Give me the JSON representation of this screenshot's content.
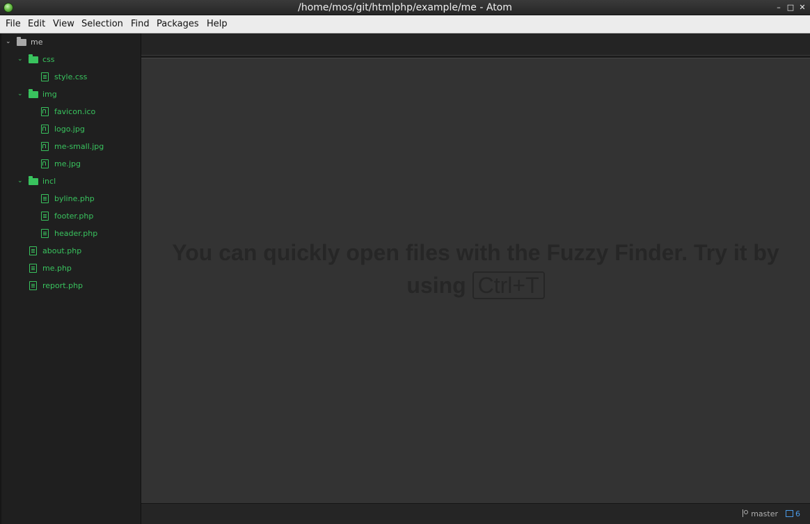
{
  "window": {
    "title": "/home/mos/git/htmlphp/example/me - Atom",
    "controls": {
      "minimize": "–",
      "maximize": "□",
      "close": "✕"
    }
  },
  "menubar": {
    "items": [
      "File",
      "Edit",
      "View",
      "Selection",
      "Find",
      "Packages",
      "Help"
    ]
  },
  "tree": {
    "root": "me",
    "items": [
      {
        "label": "css",
        "type": "folder",
        "expanded": true
      },
      {
        "label": "style.css",
        "type": "file"
      },
      {
        "label": "img",
        "type": "folder",
        "expanded": true
      },
      {
        "label": "favicon.ico",
        "type": "image"
      },
      {
        "label": "logo.jpg",
        "type": "image"
      },
      {
        "label": "me-small.jpg",
        "type": "image"
      },
      {
        "label": "me.jpg",
        "type": "image"
      },
      {
        "label": "incl",
        "type": "folder",
        "expanded": true
      },
      {
        "label": "byline.php",
        "type": "file"
      },
      {
        "label": "footer.php",
        "type": "file"
      },
      {
        "label": "header.php",
        "type": "file"
      },
      {
        "label": "about.php",
        "type": "file"
      },
      {
        "label": "me.php",
        "type": "file"
      },
      {
        "label": "report.php",
        "type": "file"
      }
    ]
  },
  "editor": {
    "hint_text": "You can quickly open files with the Fuzzy Finder. Try it by using",
    "hint_key": "Ctrl+T"
  },
  "statusbar": {
    "branch": "master",
    "package_count": "6"
  },
  "colors": {
    "tree_text": "#39c35e",
    "editor_bg": "#333333",
    "status_accent": "#4b9be8"
  }
}
